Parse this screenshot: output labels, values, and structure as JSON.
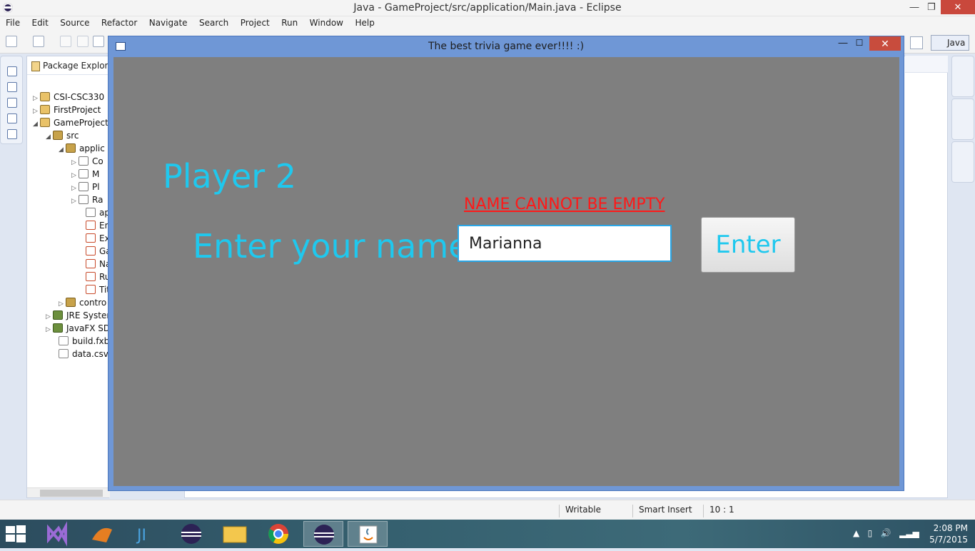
{
  "eclipse": {
    "title": "Java - GameProject/src/application/Main.java - Eclipse",
    "menu": [
      "File",
      "Edit",
      "Source",
      "Refactor",
      "Navigate",
      "Search",
      "Project",
      "Run",
      "Window",
      "Help"
    ],
    "perspective": "Java",
    "package_explorer": {
      "tab_label": "Package Explorer",
      "rows": [
        {
          "label": "CSI-CSC330",
          "icon": "project-icon",
          "twisty": "▷"
        },
        {
          "label": "FirstProject",
          "icon": "project-icon",
          "twisty": "▷"
        },
        {
          "label": "GameProject",
          "icon": "project-icon",
          "twisty": "◢"
        },
        {
          "label": "src",
          "icon": "source-folder-icon",
          "twisty": "◢"
        },
        {
          "label": "applic",
          "icon": "package-icon",
          "twisty": "◢"
        },
        {
          "label": "Co",
          "icon": "java-file-icon",
          "twisty": "▷"
        },
        {
          "label": "M",
          "icon": "java-file-icon",
          "twisty": "▷"
        },
        {
          "label": "Pl",
          "icon": "java-file-icon",
          "twisty": "▷"
        },
        {
          "label": "Ra",
          "icon": "java-file-icon",
          "twisty": "▷"
        },
        {
          "label": "ap",
          "icon": "css-file-icon",
          "twisty": ""
        },
        {
          "label": "En",
          "icon": "fxml-file-icon",
          "twisty": ""
        },
        {
          "label": "Ex",
          "icon": "fxml-file-icon",
          "twisty": ""
        },
        {
          "label": "Ga",
          "icon": "fxml-file-icon",
          "twisty": ""
        },
        {
          "label": "Na",
          "icon": "fxml-file-icon",
          "twisty": ""
        },
        {
          "label": "Ru",
          "icon": "fxml-file-icon",
          "twisty": ""
        },
        {
          "label": "Tit",
          "icon": "fxml-file-icon",
          "twisty": ""
        },
        {
          "label": "contro",
          "icon": "package-icon",
          "twisty": "▷"
        },
        {
          "label": "JRE Systen",
          "icon": "library-icon",
          "twisty": "▷"
        },
        {
          "label": "JavaFX SD",
          "icon": "library-icon",
          "twisty": "▷"
        },
        {
          "label": "build.fxbu",
          "icon": "build-file-icon",
          "twisty": ""
        },
        {
          "label": "data.csv",
          "icon": "csv-file-icon",
          "twisty": ""
        }
      ]
    },
    "status": {
      "writable": "Writable",
      "insert_mode": "Smart Insert",
      "cursor_position": "10 : 1"
    }
  },
  "game": {
    "window_title": "The best trivia game ever!!!!  :)",
    "player_label": "Player 2",
    "error_message": "NAME CANNOT BE EMPTY",
    "prompt_label": "Enter your name:",
    "name_value": "Marianna",
    "enter_button": "Enter"
  },
  "taskbar": {
    "apps": [
      "visual-studio-icon",
      "matlab-icon",
      "intellij-icon",
      "eclipse-icon",
      "file-explorer-icon",
      "chrome-icon",
      "eclipse-icon",
      "java-icon"
    ],
    "time": "2:08 PM",
    "date": "5/7/2015"
  },
  "colors": {
    "accent_cyan": "#1fc8ee",
    "error_red": "#ff1818",
    "game_background": "#7f7f7f",
    "window_frame": "#6f97d6"
  }
}
